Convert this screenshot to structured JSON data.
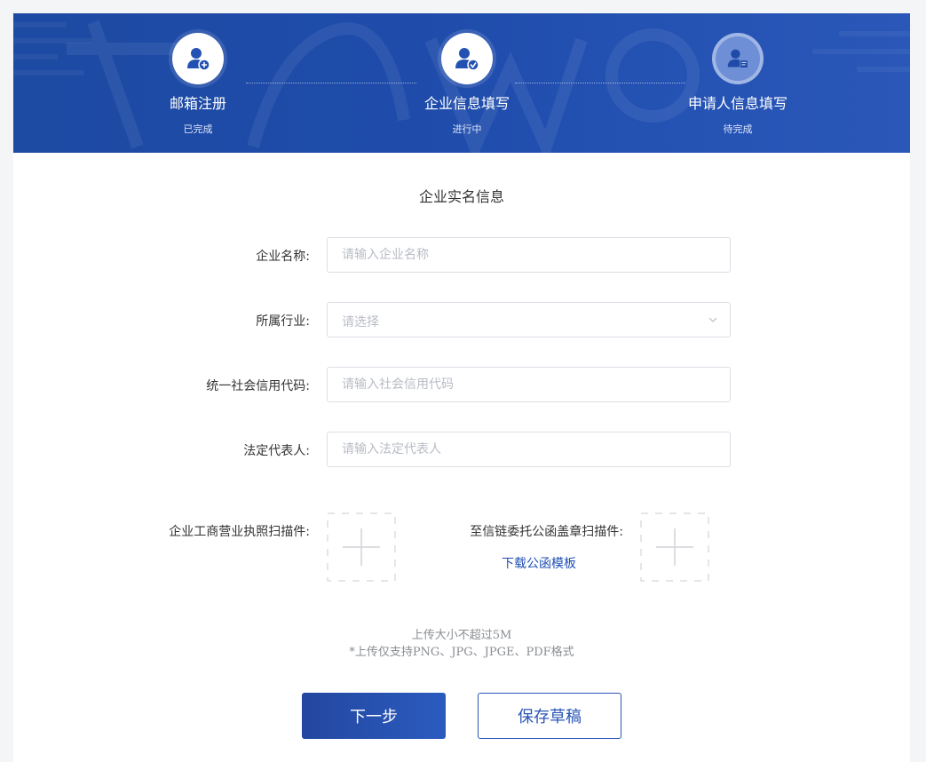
{
  "steps": [
    {
      "title": "邮箱注册",
      "status": "已完成",
      "icon": "user-add-icon"
    },
    {
      "title": "企业信息填写",
      "status": "进行中",
      "icon": "user-check-icon"
    },
    {
      "title": "申请人信息填写",
      "status": "待完成",
      "icon": "user-card-icon"
    }
  ],
  "form": {
    "section_title": "企业实名信息",
    "company_name": {
      "label": "企业名称:",
      "placeholder": "请输入企业名称",
      "value": ""
    },
    "industry": {
      "label": "所属行业:",
      "placeholder": "请选择",
      "value": ""
    },
    "credit_code": {
      "label": "统一社会信用代码:",
      "placeholder": "请输入社会信用代码",
      "value": ""
    },
    "legal_rep": {
      "label": "法定代表人:",
      "placeholder": "请输入法定代表人",
      "value": ""
    },
    "license_upload": {
      "label": "企业工商营业执照扫描件:"
    },
    "letter_upload": {
      "label": "至信链委托公函盖章扫描件:",
      "template_link": "下载公函模板"
    },
    "notes": [
      "上传大小不超过5M",
      "*上传仅支持PNG、JPG、JPGE、PDF格式"
    ]
  },
  "buttons": {
    "next": "下一步",
    "save_draft": "保存草稿"
  },
  "colors": {
    "brand": "#1f4cab",
    "link": "#1f4fb3",
    "placeholder": "#b8bcc4"
  }
}
